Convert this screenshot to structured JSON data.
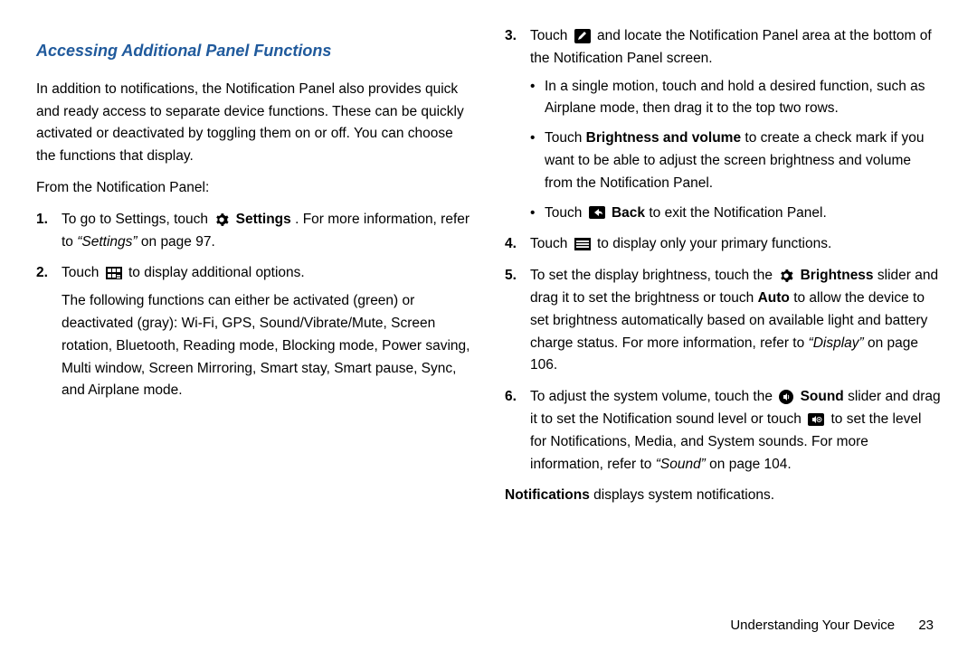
{
  "heading": "Accessing Additional Panel Functions",
  "left": {
    "intro": "In addition to notifications, the Notification Panel also provides quick and ready access to separate device functions. These can be quickly activated or deactivated by toggling them on or off. You can choose the functions that display.",
    "from": "From the Notification Panel:",
    "item1": {
      "num": "1.",
      "t1": "To go to Settings, touch ",
      "settings": "Settings",
      "t2": ". For more information, refer to ",
      "ref": "“Settings”",
      "t3": " on page 97."
    },
    "item2": {
      "num": "2.",
      "t1": "Touch ",
      "t2": " to display additional options.",
      "p2": "The following functions can either be activated (green) or deactivated (gray): Wi-Fi, GPS, Sound/Vibrate/Mute, Screen rotation, Bluetooth, Reading mode, Blocking mode, Power saving, Multi window, Screen Mirroring, Smart stay, Smart pause, Sync, and Airplane mode."
    }
  },
  "right": {
    "item3": {
      "num": "3.",
      "t1": "Touch ",
      "t2": " and locate the Notification Panel area at the bottom of the Notification Panel screen.",
      "b1a": "In a single motion, touch and hold a desired function, such as Airplane mode, then drag it to the top two rows.",
      "b2_pre": "Touch ",
      "b2_bold": "Brightness and volume",
      "b2_post": " to create a check mark if you want to be able to adjust the screen brightness and volume from the Notification Panel.",
      "b3_pre": "Touch ",
      "b3_bold": "Back",
      "b3_post": " to exit the Notification Panel."
    },
    "item4": {
      "num": "4.",
      "t1": "Touch ",
      "t2": " to display only your primary functions."
    },
    "item5": {
      "num": "5.",
      "t1": "To set the display brightness, touch the ",
      "b": "Brightness",
      "t2": " slider and drag it to set the brightness or touch ",
      "auto": "Auto",
      "t3": " to allow the device to set brightness automatically based on available light and battery charge status. For more information, refer to ",
      "ref": "“Display”",
      "t4": " on page 106."
    },
    "item6": {
      "num": "6.",
      "t1": "To adjust the system volume, touch the ",
      "b": "Sound",
      "t2": " slider and drag it to set the Notification sound level or touch ",
      "t3": " to set the level for Notifications, Media, and System sounds. For more information, refer to ",
      "ref": "“Sound”",
      "t4": " on page 104."
    },
    "note_b": "Notifications",
    "note_t": " displays system notifications."
  },
  "footer": {
    "section": "Understanding Your Device",
    "page": "23"
  }
}
